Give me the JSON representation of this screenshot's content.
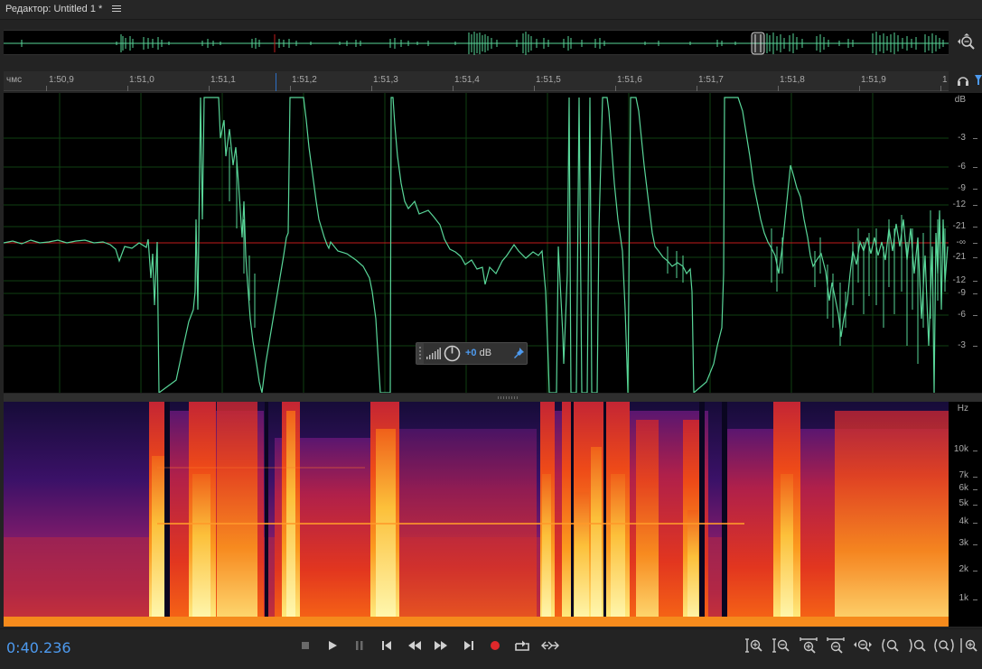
{
  "panel": {
    "title": "Редактор: Untitled 1 *"
  },
  "ruler": {
    "units_label": "чмс",
    "ticks": [
      "1:50,9",
      "1:51,0",
      "1:51,1",
      "1:51,2",
      "1:51,3",
      "1:51,4",
      "1:51,5",
      "1:51,6",
      "1:51,7",
      "1:51,8",
      "1:51,9",
      "1"
    ]
  },
  "amplitude_scale": {
    "labels": [
      "dB",
      "-3",
      "-6",
      "-9",
      "-12",
      "-21",
      "-∞",
      "-21",
      "-12",
      "-9",
      "-6",
      "-3"
    ]
  },
  "frequency_scale": {
    "labels": [
      "Hz",
      "10k",
      "7k",
      "6k",
      "5k",
      "4k",
      "3k",
      "2k",
      "1k"
    ]
  },
  "hud": {
    "value_label": "+0",
    "unit_label": "dB"
  },
  "transport": {
    "current_time": "0:40.236",
    "buttons": [
      "stop",
      "play",
      "pause",
      "move-playhead-previous",
      "rewind",
      "fast-forward",
      "move-playhead-next",
      "record",
      "loop-playback",
      "skip-selection"
    ]
  },
  "zoom": {
    "buttons": [
      "zoom-in-amplitude",
      "zoom-out-amplitude",
      "zoom-in-time",
      "zoom-out-time",
      "zoom-out-full",
      "zoom-in-at-in-point",
      "zoom-in-at-out-point",
      "zoom-to-selection",
      "zoom-selection-edges"
    ]
  },
  "colors": {
    "waveform": "#59d699",
    "playhead": "#2d6fc4",
    "time_display": "#4d9aef",
    "record": "#e0282b",
    "center_line": "#c21d1d",
    "grid": "#0f4012"
  },
  "icons": {
    "panel_menu": "hamburger-icon",
    "overview_zoom": "zoom-navigator-icon",
    "monitor": "headphones-icon",
    "filter": "filter-icon",
    "hud_meter": "level-meter-icon",
    "hud_knob": "amplitude-knob-icon",
    "hud_pin": "pin-icon"
  }
}
